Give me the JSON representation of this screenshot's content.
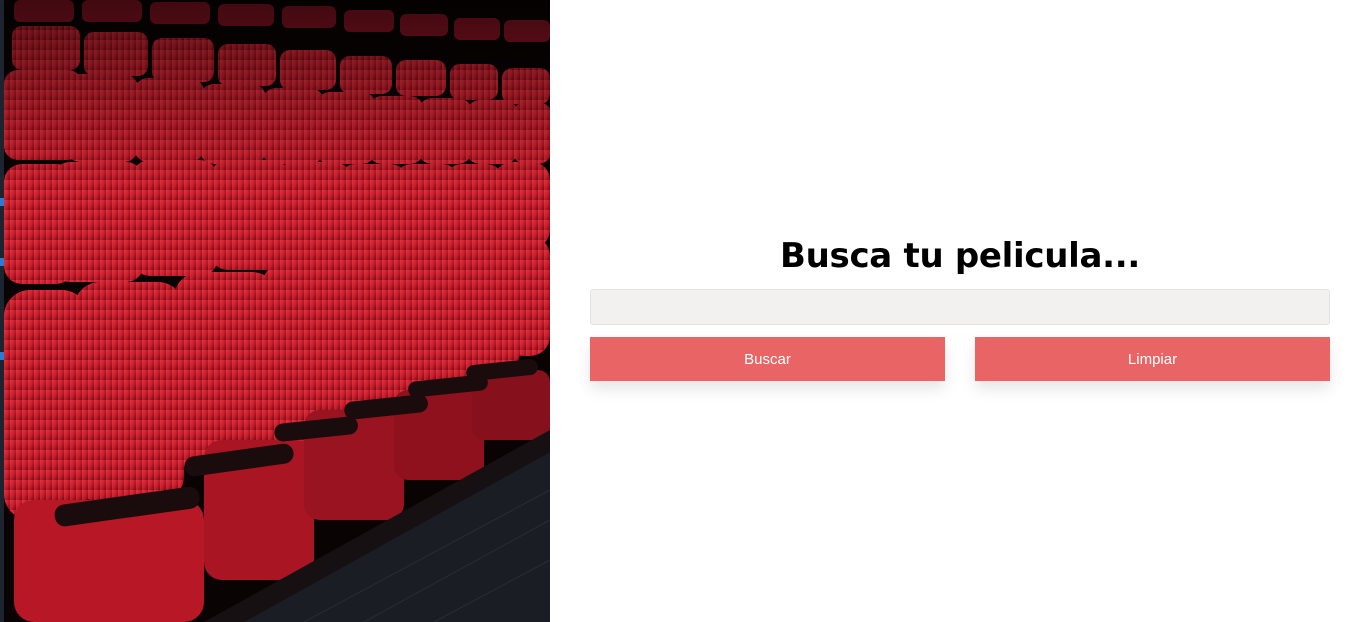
{
  "hero": {
    "image": "theater-seats-photo",
    "seat_color": "#c81e2c"
  },
  "search": {
    "title": "Busca tu pelicula...",
    "input_value": "",
    "input_placeholder": "",
    "search_button_label": "Buscar",
    "clear_button_label": "Limpiar",
    "button_color": "#e96565"
  }
}
